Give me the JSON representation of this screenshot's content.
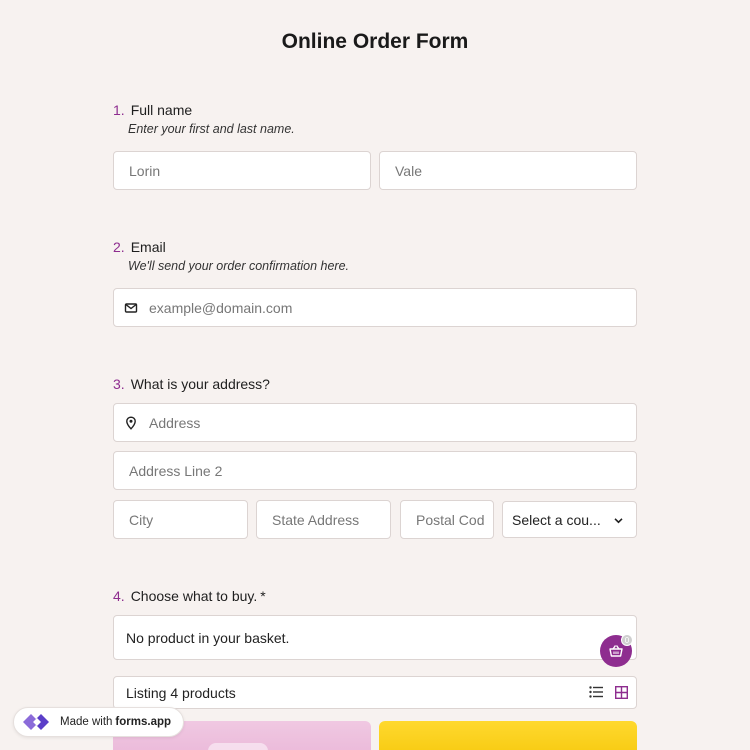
{
  "title": "Online Order Form",
  "q1": {
    "num": "1.",
    "label": "Full name",
    "desc": "Enter your first and last name.",
    "first_value": "Lorin",
    "last_value": "Vale"
  },
  "q2": {
    "num": "2.",
    "label": "Email",
    "desc": "We'll send your order confirmation here.",
    "placeholder": "example@domain.com"
  },
  "q3": {
    "num": "3.",
    "label": "What is your address?",
    "address_placeholder": "Address",
    "address2_placeholder": "Address Line 2",
    "city_placeholder": "City",
    "state_placeholder": "State Address",
    "postal_placeholder": "Postal Cod",
    "country_selected": "Select a cou..."
  },
  "q4": {
    "num": "4.",
    "label": "Choose what to buy.",
    "required_mark": "*",
    "basket_text": "No product in your basket.",
    "basket_count": "0",
    "listing_text": "Listing 4 products"
  },
  "badge": {
    "prefix": "Made with",
    "brand": "forms.app"
  },
  "colors": {
    "accent": "#8e2d8f",
    "background": "#f7f2f0"
  }
}
